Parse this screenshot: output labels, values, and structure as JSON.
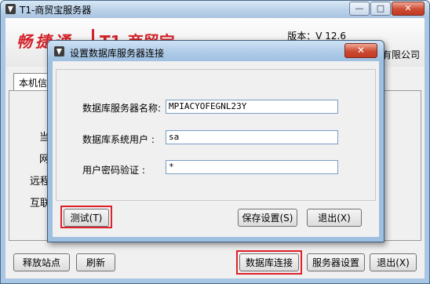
{
  "window": {
    "title": "T1-商贸宝服务器",
    "controls": {
      "minimize": "—",
      "maximize": "□",
      "close": "✕"
    }
  },
  "banner": {
    "brand": "畅捷通",
    "brand_product": "T1-商贸宝",
    "version": "版本：V 12.6",
    "company": "有限公司"
  },
  "tab": {
    "label": "本机信"
  },
  "background_labels": [
    "当",
    "网",
    "远程",
    "互联"
  ],
  "footer": {
    "release_site": "释放站点",
    "refresh": "刷新",
    "db_connect": "数据库连接",
    "server_settings": "服务器设置",
    "exit": "退出(X)"
  },
  "dialog": {
    "title": "设置数据库服务器连接",
    "close": "✕",
    "fields": {
      "server_name_label": "数据库服务器名称:",
      "server_name_value": "MPIACYOFEGNL23Y",
      "user_label": "数据库系统用户 :",
      "user_value": "sa",
      "password_label": "用户密码验证 :",
      "password_value": "*"
    },
    "buttons": {
      "test": "测试(T)",
      "save": "保存设置(S)",
      "exit": "退出(X)"
    }
  },
  "colors": {
    "highlight": "#e0202a",
    "brand": "#d3222a"
  }
}
